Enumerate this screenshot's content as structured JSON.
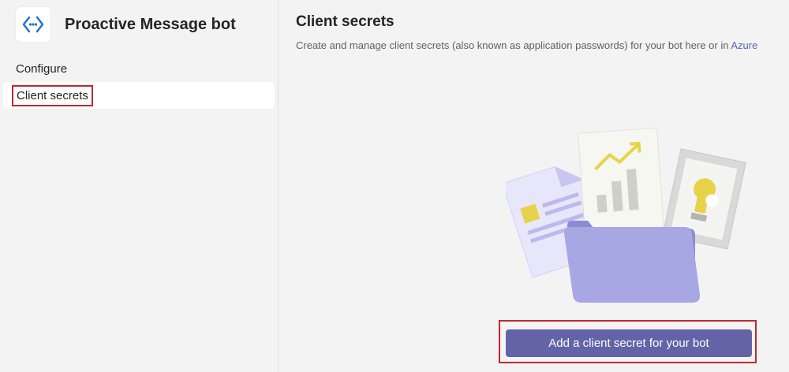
{
  "app": {
    "title": "Proactive Message bot",
    "icon": "bot-app-icon"
  },
  "sidebar": {
    "items": [
      {
        "label": "Configure",
        "selected": false
      },
      {
        "label": "Client secrets",
        "selected": true
      }
    ]
  },
  "main": {
    "title": "Client secrets",
    "description": "Create and manage client secrets (also known as application passwords) for your bot here or in ",
    "description_link": "Azure",
    "illustration": "documents-folder-illustration",
    "cta_label": "Add a client secret for your bot"
  },
  "colors": {
    "accent": "#6264a7",
    "highlight": "#c4262e",
    "link": "#5b5fc7"
  }
}
